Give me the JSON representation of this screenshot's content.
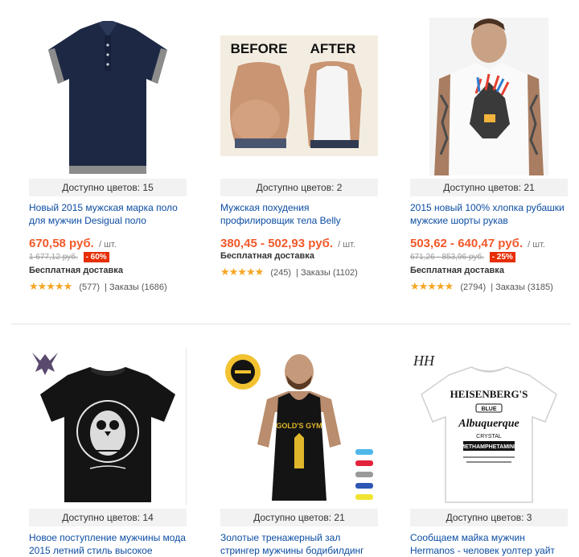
{
  "products": [
    {
      "colors_label": "Доступно цветов: 15",
      "title": "Новый 2015 мужская марка поло для мужчин Desigual поло",
      "price": "670,58 руб.",
      "unit": "/ шт.",
      "old_price": "1 677,12 руб.",
      "discount": "- 60%",
      "shipping": "Бесплатная доставка",
      "stars": "★★★★★",
      "reviews": "(577)",
      "orders": "| Заказы (1686)",
      "image_icon": "navy-polo-shirt"
    },
    {
      "colors_label": "Доступно цветов: 2",
      "title": "Мужская похудения профилировщик тела Belly",
      "price": "380,45 - 502,93 руб.",
      "unit": "/ шт.",
      "old_price": "",
      "discount": "",
      "shipping": "Бесплатная доставка",
      "stars": "★★★★★",
      "reviews": "(245)",
      "orders": "| Заказы (1102)",
      "image_icon": "before-after-body-shaper",
      "image_text_before": "BEFORE",
      "image_text_after": "AFTER"
    },
    {
      "colors_label": "Доступно цветов: 21",
      "title": "2015 новый 100% хлопка рубашки мужские шорты рукав",
      "price": "503,62 - 640,47 руб.",
      "unit": "/ шт.",
      "old_price": "671,26 - 853,96 руб.",
      "discount": "- 25%",
      "shipping": "Бесплатная доставка",
      "stars": "★★★★★",
      "reviews": "(2794)",
      "orders": "| Заказы (3185)",
      "image_icon": "white-printed-tshirt-model"
    },
    {
      "colors_label": "Доступно цветов: 14",
      "title": "Новое поступление мужчины мода 2015 летний стиль высокое",
      "image_icon": "black-owl-tshirt"
    },
    {
      "colors_label": "Доступно цветов: 21",
      "title": "Золотые тренажерный зал стрингер мужчины бодибилдинг",
      "image_icon": "gym-tank-top-model",
      "image_logo_text": "GOLD'S GYM"
    },
    {
      "colors_label": "Доступно цветов: 3",
      "title": "Сообщаем майка мужчин Hermanos - человек уолтер уайт",
      "image_icon": "white-heisenberg-tshirt",
      "image_text_main": "HEISENBERG'S",
      "image_text_blue": "BLUE",
      "image_text_city": "Albuquerque",
      "image_text_crystal": "CRYSTAL",
      "image_text_meth": "METHAMPHETAMINE",
      "image_brand": "HH"
    }
  ],
  "colors": {
    "link": "#0c4da2",
    "price": "#f2592a",
    "discount_bg": "#e62e04",
    "star": "#f5a623",
    "bar_bg": "#f2f2f2"
  }
}
